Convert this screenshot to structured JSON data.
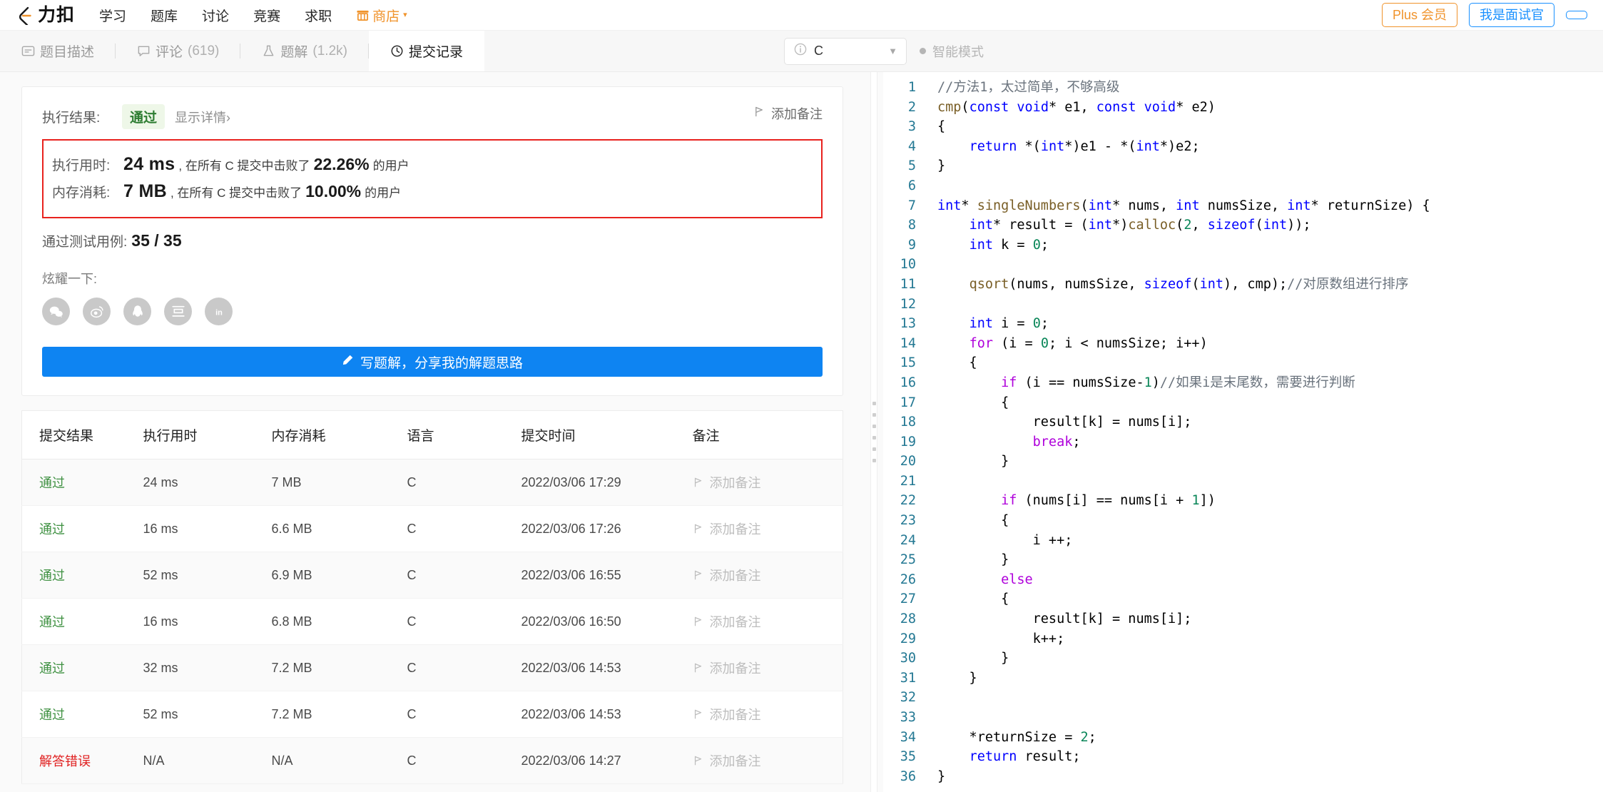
{
  "header": {
    "logo_text": "力扣",
    "nav": [
      {
        "label": "学习",
        "name": "nav-study"
      },
      {
        "label": "题库",
        "name": "nav-problems"
      },
      {
        "label": "讨论",
        "name": "nav-discuss"
      },
      {
        "label": "竞赛",
        "name": "nav-contest"
      },
      {
        "label": "求职",
        "name": "nav-jobs"
      },
      {
        "label": "商店",
        "name": "nav-store"
      }
    ],
    "plus_label": "Plus 会员",
    "interviewer_label": "我是面试官"
  },
  "tabs": [
    {
      "label": "题目描述",
      "count": "",
      "icon": "description-icon",
      "active": false
    },
    {
      "label": "评论",
      "count": "(619)",
      "icon": "comment-icon",
      "active": false
    },
    {
      "label": "题解",
      "count": "(1.2k)",
      "icon": "flask-icon",
      "active": false
    },
    {
      "label": "提交记录",
      "count": "",
      "icon": "clock-icon",
      "active": true
    }
  ],
  "toolbar": {
    "language": "C",
    "smart_mode": "智能模式"
  },
  "result": {
    "exec_result_label": "执行结果:",
    "status": "通过",
    "show_detail": "显示详情",
    "show_detail_arrow": "›",
    "runtime_label": "执行用时:",
    "runtime_value": "24 ms",
    "runtime_mid": ", 在所有 C 提交中击败了",
    "runtime_pct": "22.26%",
    "runtime_suffix": "的用户",
    "memory_label": "内存消耗:",
    "memory_value": "7 MB",
    "memory_mid": ", 在所有 C 提交中击败了",
    "memory_pct": "10.00%",
    "memory_suffix": "的用户",
    "cases_label": "通过测试用例:",
    "cases_value": "35 / 35",
    "flaunt_label": "炫耀一下:",
    "share_icons": [
      "wechat-icon",
      "weibo-icon",
      "qq-icon",
      "douban-icon",
      "linkedin-icon"
    ],
    "write_solution": "写题解，分享我的解题思路",
    "add_note": "添加备注"
  },
  "table": {
    "headers": [
      "提交结果",
      "执行用时",
      "内存消耗",
      "语言",
      "提交时间",
      "备注"
    ],
    "rows": [
      {
        "status": "通过",
        "pass": true,
        "time": "24 ms",
        "mem": "7 MB",
        "lang": "C",
        "when": "2022/03/06 17:29",
        "note": "添加备注"
      },
      {
        "status": "通过",
        "pass": true,
        "time": "16 ms",
        "mem": "6.6 MB",
        "lang": "C",
        "when": "2022/03/06 17:26",
        "note": "添加备注"
      },
      {
        "status": "通过",
        "pass": true,
        "time": "52 ms",
        "mem": "6.9 MB",
        "lang": "C",
        "when": "2022/03/06 16:55",
        "note": "添加备注"
      },
      {
        "status": "通过",
        "pass": true,
        "time": "16 ms",
        "mem": "6.8 MB",
        "lang": "C",
        "when": "2022/03/06 16:50",
        "note": "添加备注"
      },
      {
        "status": "通过",
        "pass": true,
        "time": "32 ms",
        "mem": "7.2 MB",
        "lang": "C",
        "when": "2022/03/06 14:53",
        "note": "添加备注"
      },
      {
        "status": "通过",
        "pass": true,
        "time": "52 ms",
        "mem": "7.2 MB",
        "lang": "C",
        "when": "2022/03/06 14:53",
        "note": "添加备注"
      },
      {
        "status": "解答错误",
        "pass": false,
        "time": "N/A",
        "mem": "N/A",
        "lang": "C",
        "when": "2022/03/06 14:27",
        "note": "添加备注"
      }
    ]
  },
  "code": {
    "language": "C",
    "lines": [
      {
        "n": 1,
        "text": "//方法1，太过简单，不够高级"
      },
      {
        "n": 2,
        "text": "cmp(const void* e1, const void* e2)"
      },
      {
        "n": 3,
        "text": "{"
      },
      {
        "n": 4,
        "text": "    return *(int*)e1 - *(int*)e2;"
      },
      {
        "n": 5,
        "text": "}"
      },
      {
        "n": 6,
        "text": ""
      },
      {
        "n": 7,
        "text": "int* singleNumbers(int* nums, int numsSize, int* returnSize) {"
      },
      {
        "n": 8,
        "text": "    int* result = (int*)calloc(2, sizeof(int));"
      },
      {
        "n": 9,
        "text": "    int k = 0;"
      },
      {
        "n": 10,
        "text": ""
      },
      {
        "n": 11,
        "text": "    qsort(nums, numsSize, sizeof(int), cmp);//对原数组进行排序"
      },
      {
        "n": 12,
        "text": ""
      },
      {
        "n": 13,
        "text": "    int i = 0;"
      },
      {
        "n": 14,
        "text": "    for (i = 0; i < numsSize; i++)"
      },
      {
        "n": 15,
        "text": "    {"
      },
      {
        "n": 16,
        "text": "        if (i == numsSize-1)//如果i是末尾数，需要进行判断"
      },
      {
        "n": 17,
        "text": "        {"
      },
      {
        "n": 18,
        "text": "            result[k] = nums[i];"
      },
      {
        "n": 19,
        "text": "            break;"
      },
      {
        "n": 20,
        "text": "        }"
      },
      {
        "n": 21,
        "text": ""
      },
      {
        "n": 22,
        "text": "        if (nums[i] == nums[i + 1])"
      },
      {
        "n": 23,
        "text": "        {"
      },
      {
        "n": 24,
        "text": "            i ++;"
      },
      {
        "n": 25,
        "text": "        }"
      },
      {
        "n": 26,
        "text": "        else"
      },
      {
        "n": 27,
        "text": "        {"
      },
      {
        "n": 28,
        "text": "            result[k] = nums[i];"
      },
      {
        "n": 29,
        "text": "            k++;"
      },
      {
        "n": 30,
        "text": "        }"
      },
      {
        "n": 31,
        "text": "    }"
      },
      {
        "n": 32,
        "text": ""
      },
      {
        "n": 33,
        "text": ""
      },
      {
        "n": 34,
        "text": "    *returnSize = 2;"
      },
      {
        "n": 35,
        "text": "    return result;"
      },
      {
        "n": 36,
        "text": "}"
      }
    ]
  },
  "colors": {
    "accent_blue": "#1890ff",
    "plus_orange": "#f0932b",
    "pass_green": "#3f9142",
    "fail_red": "#e02020",
    "highlight_box": "#e8221e",
    "button_blue": "#0e84f2"
  }
}
